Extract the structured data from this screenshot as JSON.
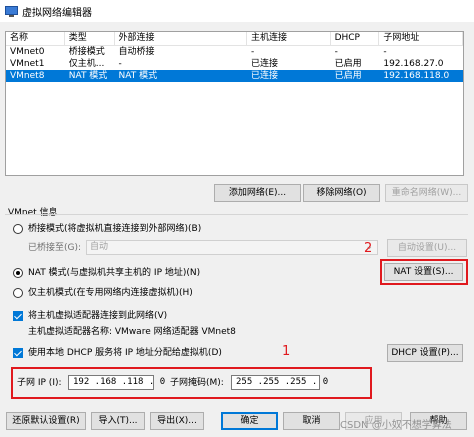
{
  "window": {
    "title": "虚拟网络编辑器"
  },
  "table": {
    "headers": [
      "名称",
      "类型",
      "外部连接",
      "主机连接",
      "DHCP",
      "子网地址"
    ],
    "rows": [
      [
        "VMnet0",
        "桥接模式",
        "自动桥接",
        "-",
        "-",
        "-"
      ],
      [
        "VMnet1",
        "仅主机...",
        "-",
        "已连接",
        "已启用",
        "192.168.27.0"
      ],
      [
        "VMnet8",
        "NAT 模式",
        "NAT 模式",
        "已连接",
        "已启用",
        "192.168.118.0"
      ]
    ],
    "selected_row": 2
  },
  "list_buttons": {
    "add_network": "添加网络(E)...",
    "remove_network": "移除网络(O)",
    "rename_network": "重命名网络(W)..."
  },
  "vmnet_info": {
    "heading": "VMnet 信息",
    "bridged_mode": "桥接模式(将虚拟机直接连接到外部网络)(B)",
    "bridged_to_label": "已桥接至(G):",
    "bridged_to_value": "自动",
    "auto_settings": "自动设置(U)...",
    "nat_mode": "NAT 模式(与虚拟机共享主机的 IP 地址)(N)",
    "nat_settings": "NAT 设置(S)...",
    "host_only_mode": "仅主机模式(在专用网络内连接虚拟机)(H)",
    "connect_adapter": "将主机虚拟适配器连接到此网络(V)",
    "adapter_name": "主机虚拟适配器名称: VMware 网络适配器 VMnet8",
    "use_dhcp": "使用本地 DHCP 服务将 IP 地址分配给虚拟机(D)",
    "dhcp_settings": "DHCP 设置(P)...",
    "subnet_ip_label": "子网 IP (I):",
    "subnet_ip_value": "192 .168 .118 . 0",
    "subnet_mask_label": "子网掩码(M):",
    "subnet_mask_value": "255 .255 .255 . 0"
  },
  "bottom_buttons": {
    "restore_defaults": "还原默认设置(R)",
    "import": "导入(T)...",
    "export": "导出(X)...",
    "ok": "确定",
    "cancel": "取消",
    "apply": "应用",
    "help": "帮助"
  },
  "annotations": {
    "marker_1": "1",
    "marker_2": "2"
  },
  "watermark": "CSDN @小奴不想学算法",
  "colors": {
    "selection": "#0078d7",
    "annotation": "#e0191e"
  }
}
